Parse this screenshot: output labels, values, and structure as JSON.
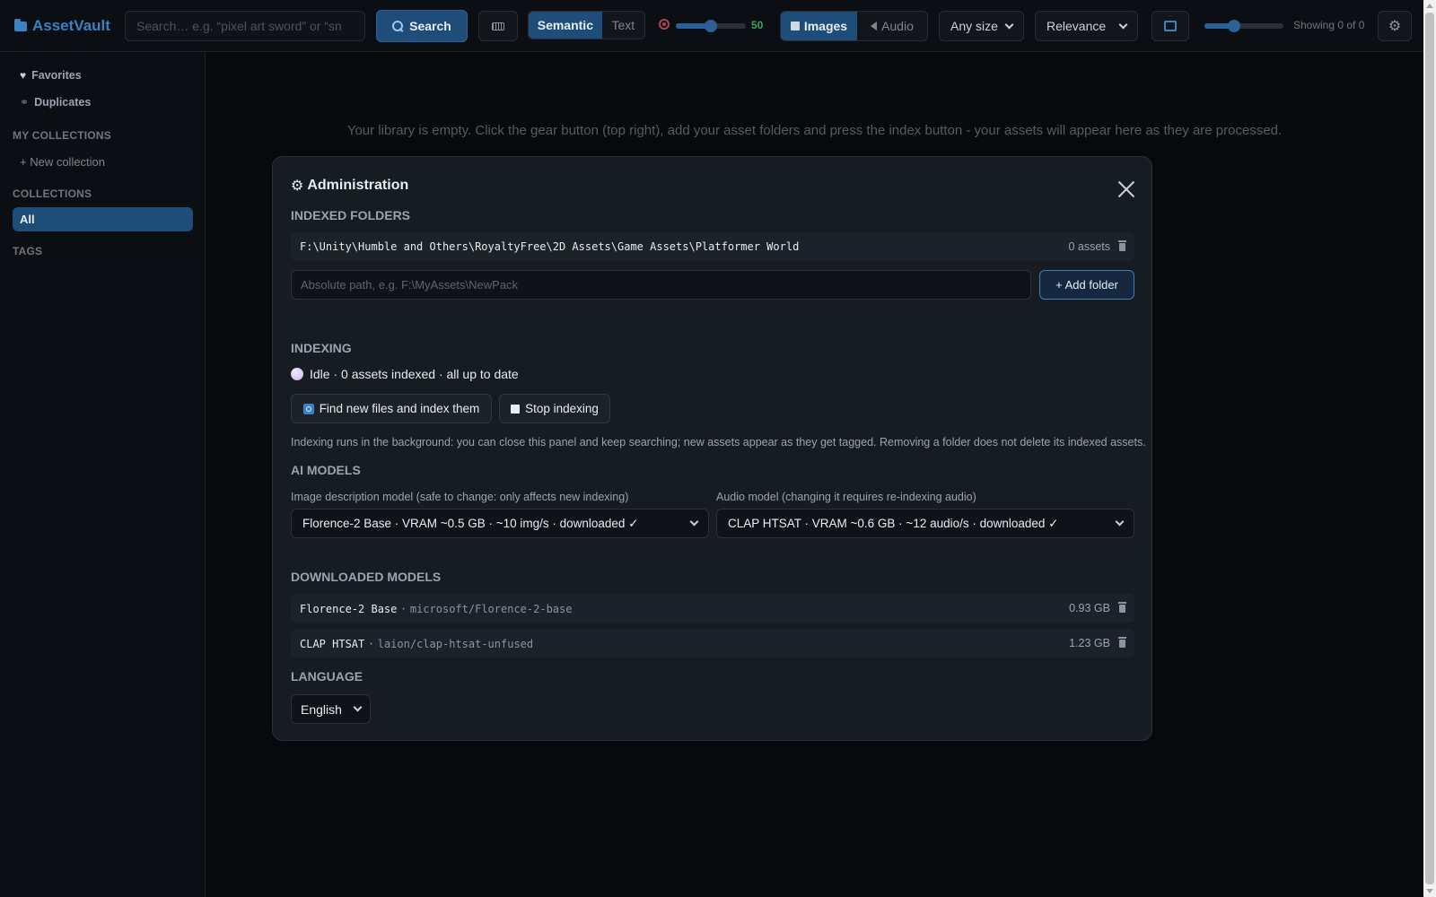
{
  "app": {
    "name": "AssetVault",
    "accent_color": "#1f4d7a"
  },
  "toolbar": {
    "search_placeholder": "Search… e.g. “pixel art sword” or “sn",
    "search_button": "Search",
    "mode_semantic": "Semantic",
    "mode_text": "Text",
    "threshold_value": "50",
    "threshold_fraction": 0.5,
    "type_images": "Images",
    "type_audio": "Audio",
    "size_filter": "Any size",
    "sort_by": "Relevance",
    "thumb_size_fraction": 0.38,
    "showing": "Showing 0 of 0",
    "settings_icon": "⚙"
  },
  "sidebar": {
    "favorites": "Favorites",
    "duplicates": "Duplicates",
    "my_collections_heading": "MY COLLECTIONS",
    "new_collection": "+ New collection",
    "collections_heading": "COLLECTIONS",
    "all_item": "All",
    "tags_heading": "TAGS"
  },
  "main": {
    "empty_message": "Your library is empty. Click the gear button (top right), add your asset folders and press the index button - your assets will appear here as they are processed."
  },
  "admin": {
    "title": "Administration",
    "title_icon": "⚙",
    "indexed_folders_heading": "INDEXED FOLDERS",
    "folders": [
      {
        "path": "F:\\Unity\\Humble and Others\\RoyaltyFree\\2D Assets\\Game Assets\\Platformer World",
        "count": "0 assets"
      }
    ],
    "path_placeholder": "Absolute path, e.g. F:\\MyAssets\\NewPack",
    "add_folder_button": "+ Add folder",
    "indexing_heading": "INDEXING",
    "indexing_status": "Idle · 0 assets indexed · all up to date",
    "find_button": "Find new files and index them",
    "stop_button": "Stop indexing",
    "indexing_hint": "Indexing runs in the background: you can close this panel and keep searching; new assets appear as they get tagged. Removing a folder does not delete its indexed assets.",
    "ai_models_heading": "AI MODELS",
    "image_model_label": "Image description model (safe to change: only affects new indexing)",
    "image_model_value": "Florence-2 Base · VRAM ~0.5 GB · ~10 img/s · downloaded ✓",
    "audio_model_label": "Audio model (changing it requires re-indexing audio)",
    "audio_model_value": "CLAP HTSAT · VRAM ~0.6 GB · ~12 audio/s · downloaded ✓",
    "downloaded_heading": "DOWNLOADED MODELS",
    "downloaded_models": [
      {
        "name": "Florence-2 Base",
        "sep": "·",
        "repo": "microsoft/Florence-2-base",
        "size": "0.93 GB"
      },
      {
        "name": "CLAP HTSAT",
        "sep": "·",
        "repo": "laion/clap-htsat-unfused",
        "size": "1.23 GB"
      }
    ],
    "language_heading": "LANGUAGE",
    "language_value": "English"
  }
}
